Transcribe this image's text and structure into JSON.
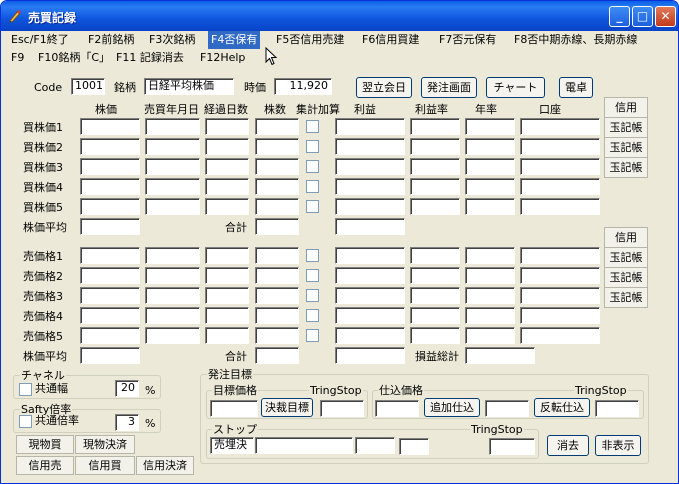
{
  "window": {
    "title": "売買記録",
    "minimize": "_",
    "maximize": "□",
    "close": "✕"
  },
  "menu": [
    {
      "label": "Esc/F1終了"
    },
    {
      "label": "F2前銘柄"
    },
    {
      "label": "F3次銘柄"
    },
    {
      "label": "F4否保有",
      "selected": true
    },
    {
      "label": "F5否信用売建"
    },
    {
      "label": "F6信用買建"
    },
    {
      "label": "F7否元保有"
    },
    {
      "label": "F8否中期赤線、長期赤線"
    },
    {
      "label": "F9"
    },
    {
      "label": "F10銘柄「C」"
    },
    {
      "label": "F11 記録消去"
    },
    {
      "label": "F12Help"
    }
  ],
  "header": {
    "code_label": "Code",
    "code_value": "1001",
    "name_label": "銘柄",
    "name_value": "日経平均株価",
    "price_label": "時価",
    "price_value": "11,920",
    "btn_next_day": "翌立会日",
    "btn_order": "発注画面",
    "btn_chart": "チャート",
    "btn_calc": "電卓"
  },
  "columns": [
    "株価",
    "売買年月日",
    "経過日数",
    "株数",
    "集計加算",
    "利益",
    "利益率",
    "年率",
    "口座"
  ],
  "buy_rows": [
    "買株価1",
    "買株価2",
    "買株価3",
    "買株価4",
    "買株価5"
  ],
  "sell_rows": [
    "売価格1",
    "売価格2",
    "売価格3",
    "売価格4",
    "売価格5"
  ],
  "buy_avg_label": "株価平均",
  "sell_avg_label": "株価平均",
  "total_label": "合計",
  "pnl_total_label": "損益総計",
  "side_buttons_buy": [
    "信用",
    "玉記帳",
    "玉記帳",
    "玉記帳"
  ],
  "side_buttons_sell": [
    "信用",
    "玉記帳",
    "玉記帳",
    "玉記帳"
  ],
  "channel": {
    "group_label": "チャネル",
    "chk_label": "共通幅",
    "value": "20",
    "unit": "%"
  },
  "safety": {
    "group_label": "Safty倍率",
    "chk_label": "共通倍率",
    "value": "3",
    "unit": "%"
  },
  "bottom_buttons": [
    "現物買",
    "現物決済",
    "信用売",
    "信用買",
    "信用決済"
  ],
  "order": {
    "group_label": "発注目標",
    "target_label": "目標価格",
    "tring_stop1": "TringStop",
    "btn_settle_target": "決裁目標",
    "buy_in_label": "仕込価格",
    "tring_stop2": "TringStop",
    "btn_add_buy": "追加仕込",
    "btn_reverse": "反転仕込",
    "stop_label": "ストップ",
    "tring_stop3": "TringStop",
    "stop_value": "売埋決",
    "btn_clear": "消去",
    "btn_hide": "非表示"
  }
}
